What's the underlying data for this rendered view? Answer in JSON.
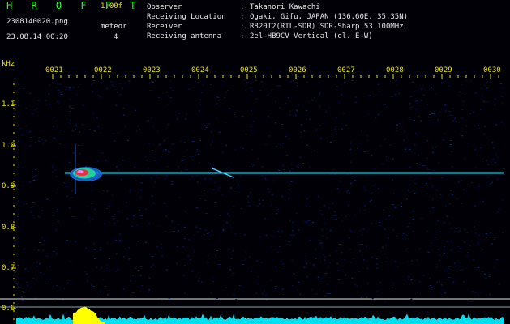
{
  "header": {
    "app_title": "H R O F F T",
    "version": "1.00f",
    "filename": "2308140020.png",
    "datetime": "23.08.14 00:20",
    "meteor_label": "meteor",
    "meteor_count": "4"
  },
  "station_info": [
    {
      "key": "Observer",
      "value": "Takanori Kawachi"
    },
    {
      "key": "Receiving Location",
      "value": "Ogaki, Gifu, JAPAN (136.60E, 35.35N)"
    },
    {
      "key": "Receiver",
      "value": "R820T2(RTL-SDR) SDR-Sharp 53.100MHz"
    },
    {
      "key": "Receiving antenna",
      "value": "2el-HB9CV Vertical (el. E-W)"
    }
  ],
  "info_separator": ":",
  "y_axis": {
    "unit": "kHz",
    "labels": [
      "1.1",
      "1.0",
      "0.9",
      "0.8",
      "0.7",
      "0.6"
    ]
  },
  "time_axis": {
    "labels": [
      "0021",
      "0022",
      "0023",
      "0024",
      "0025",
      "0026",
      "0027",
      "0028",
      "0029",
      "0030"
    ]
  },
  "colors": {
    "background": "#000006",
    "title_green": "#1cff1c",
    "axis_yellow": "#e8e800",
    "carrier_cyan": "#3ce6ff",
    "noise_floor": "#00e0f0",
    "meteor_peak": "#ffff00"
  }
}
